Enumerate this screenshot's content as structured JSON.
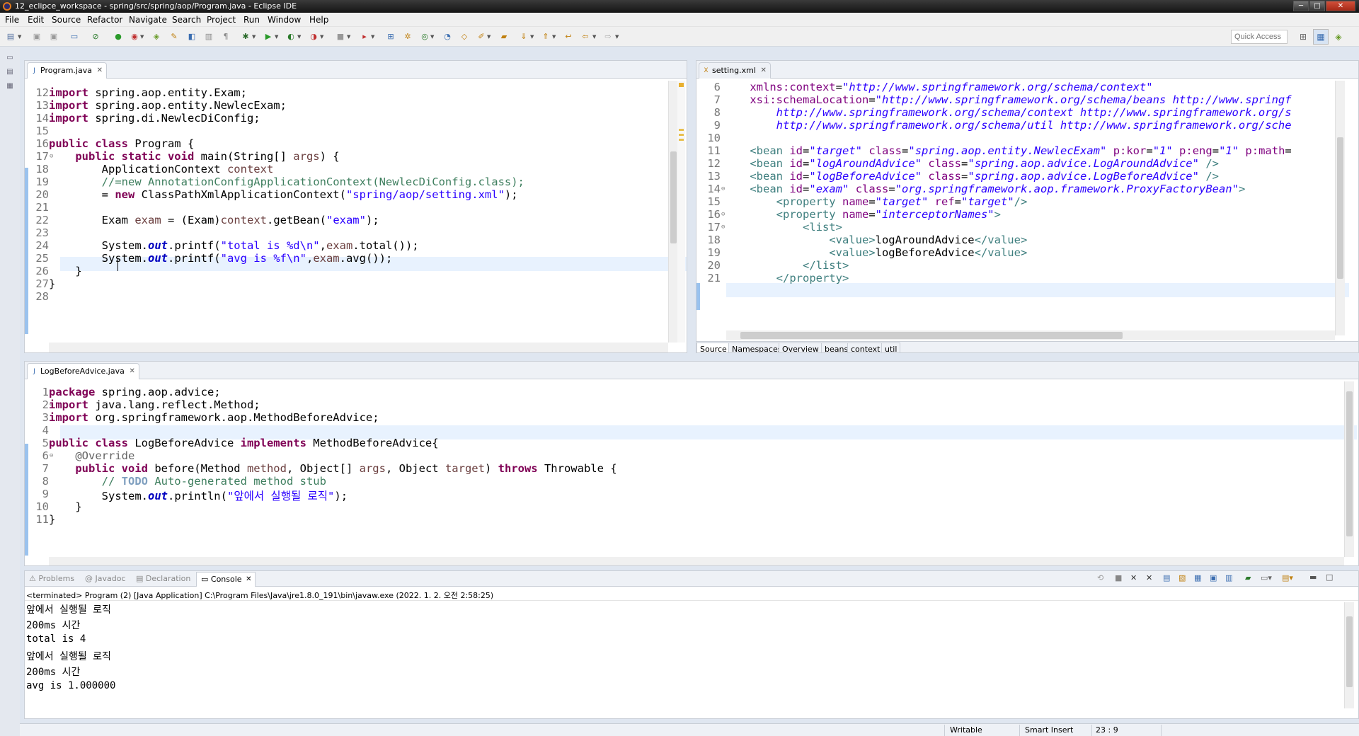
{
  "window": {
    "title": "12_eclipce_workspace - spring/src/spring/aop/Program.java - Eclipse IDE",
    "min": "─",
    "max": "□",
    "close": "✕"
  },
  "menu": [
    "File",
    "Edit",
    "Source",
    "Refactor",
    "Navigate",
    "Search",
    "Project",
    "Run",
    "Window",
    "Help"
  ],
  "toolbar": {
    "quick_access_placeholder": "Quick Access"
  },
  "editor_program": {
    "tab": "Program.java",
    "lines": [
      {
        "n": "12",
        "src": "<span class=\"kw\">import</span> spring.aop.entity.Exam;"
      },
      {
        "n": "13",
        "src": "<span class=\"kw\">import</span> spring.aop.entity.NewlecExam;"
      },
      {
        "n": "14",
        "src": "<span class=\"kw\">import</span> spring.di.NewlecDiConfig;"
      },
      {
        "n": "15",
        "src": ""
      },
      {
        "n": "16",
        "src": "<span class=\"kw\">public class</span> Program {"
      },
      {
        "n": "17",
        "src": "    <span class=\"kw\">public static void</span> main(String[] <span class=\"var\">args</span>) {"
      },
      {
        "n": "18",
        "src": "        ApplicationContext <span class=\"var\">context</span>"
      },
      {
        "n": "19",
        "src": "        <span class=\"cm\">//=new AnnotationConfigApplicationContext(NewlecDiConfig.class);</span>"
      },
      {
        "n": "20",
        "src": "        = <span class=\"kw\">new</span> ClassPathXmlApplicationContext(<span class=\"str\">\"spring/aop/setting.xml\"</span>);"
      },
      {
        "n": "21",
        "src": ""
      },
      {
        "n": "22",
        "src": "        Exam <span class=\"var\">exam</span> = (Exam)<span class=\"var\">context</span>.getBean(<span class=\"str\">\"exam\"</span>);"
      },
      {
        "n": "23",
        "src": "        "
      },
      {
        "n": "24",
        "src": "        System.<span class=\"fld\">out</span>.printf(<span class=\"str\">\"total is %d\\n\"</span>,<span class=\"var\">exam</span>.total());"
      },
      {
        "n": "25",
        "src": "        System.<span class=\"fld\">out</span>.printf(<span class=\"str\">\"avg is %f\\n\"</span>,<span class=\"var\">exam</span>.avg());"
      },
      {
        "n": "26",
        "src": "    }"
      },
      {
        "n": "27",
        "src": "}"
      },
      {
        "n": "28",
        "src": ""
      }
    ]
  },
  "editor_xml": {
    "tab": "setting.xml",
    "lines": [
      {
        "n": "6",
        "src": "    <span class=\"xa\">xmlns:context</span>=<span class=\"xv\">\"http://www.springframework.org/schema/context\"</span>"
      },
      {
        "n": "7",
        "src": "    <span class=\"xa\">xsi:schemaLocation</span>=<span class=\"xv\">\"http://www.springframework.org/schema/beans http://www.springf</span>"
      },
      {
        "n": "8",
        "src": "        <span class=\"xv\">http://www.springframework.org/schema/context http://www.springframework.org/s</span>"
      },
      {
        "n": "9",
        "src": "        <span class=\"xv\">http://www.springframework.org/schema/util http://www.springframework.org/sche</span>"
      },
      {
        "n": "10",
        "src": ""
      },
      {
        "n": "11",
        "src": "    <span class=\"xt\">&lt;bean</span> <span class=\"xa\">id</span>=<span class=\"xv\">\"target\"</span> <span class=\"xa\">class</span>=<span class=\"xv\">\"spring.aop.entity.NewlecExam\"</span> <span class=\"xa\">p:kor</span>=<span class=\"xv\">\"1\"</span> <span class=\"xa\">p:eng</span>=<span class=\"xv\">\"1\"</span> <span class=\"xa\">p:math</span>="
      },
      {
        "n": "12",
        "src": "    <span class=\"xt\">&lt;bean</span> <span class=\"xa\">id</span>=<span class=\"xv\">\"logAroundAdvice\"</span> <span class=\"xa\">class</span>=<span class=\"xv\">\"spring.aop.advice.LogAroundAdvice\"</span> <span class=\"xt\">/&gt;</span>"
      },
      {
        "n": "13",
        "src": "    <span class=\"xt\">&lt;bean</span> <span class=\"xa\">id</span>=<span class=\"xv\">\"logBeforeAdvice\"</span> <span class=\"xa\">class</span>=<span class=\"xv\">\"spring.aop.advice.LogBeforeAdvice\"</span> <span class=\"xt\">/&gt;</span>"
      },
      {
        "n": "14",
        "src": "    <span class=\"xt\">&lt;bean</span> <span class=\"xa\">id</span>=<span class=\"xv\">\"exam\"</span> <span class=\"xa\">class</span>=<span class=\"xv\">\"org.springframework.aop.framework.ProxyFactoryBean\"</span><span class=\"xt\">&gt;</span>"
      },
      {
        "n": "15",
        "src": "        <span class=\"xt\">&lt;property</span> <span class=\"xa\">name</span>=<span class=\"xv\">\"target\"</span> <span class=\"xa\">ref</span>=<span class=\"xv\">\"target\"</span><span class=\"xt\">/&gt;</span>"
      },
      {
        "n": "16",
        "src": "        <span class=\"xt\">&lt;property</span> <span class=\"xa\">name</span>=<span class=\"xv\">\"interceptorNames\"</span><span class=\"xt\">&gt;</span>"
      },
      {
        "n": "17",
        "src": "            <span class=\"xt\">&lt;list&gt;</span>"
      },
      {
        "n": "18",
        "src": "                <span class=\"xt\">&lt;value&gt;</span>logAroundAdvice<span class=\"xt\">&lt;/value&gt;</span>"
      },
      {
        "n": "19",
        "src": "                <span class=\"xt\">&lt;value&gt;</span>logBeforeAdvice<span class=\"xt\">&lt;/value&gt;</span>"
      },
      {
        "n": "20",
        "src": "            <span class=\"xt\">&lt;/list&gt;</span>"
      },
      {
        "n": "21",
        "src": "        <span class=\"xt\">&lt;/property&gt;</span>"
      }
    ],
    "bottom_tabs": [
      "Source",
      "Namespaces",
      "Overview",
      "beans",
      "context",
      "util"
    ]
  },
  "editor_advice": {
    "tab": "LogBeforeAdvice.java",
    "lines": [
      {
        "n": "1",
        "src": "<span class=\"kw\">package</span> spring.aop.advice;"
      },
      {
        "n": "2",
        "src": "<span class=\"kw\">import</span> java.lang.reflect.Method;"
      },
      {
        "n": "3",
        "src": "<span class=\"kw\">import</span> org.springframework.aop.MethodBeforeAdvice;"
      },
      {
        "n": "4",
        "src": ""
      },
      {
        "n": "5",
        "src": "<span class=\"kw\">public class</span> LogBeforeAdvice <span class=\"kw\">implements</span> MethodBeforeAdvice{"
      },
      {
        "n": "6",
        "src": "    <span class=\"ann\">@Override</span>"
      },
      {
        "n": "7",
        "src": "    <span class=\"kw\">public void</span> before(Method <span class=\"var\">method</span>, Object[] <span class=\"var\">args</span>, Object <span class=\"var\">target</span>) <span class=\"kw\">throws</span> Throwable {"
      },
      {
        "n": "8",
        "src": "        <span class=\"cm\">// <span class=\"todo\">TODO</span> Auto-generated method stub</span>"
      },
      {
        "n": "9",
        "src": "        System.<span class=\"fld\">out</span>.println(<span class=\"str\">\"앞에서 실행될 로직\"</span>);"
      },
      {
        "n": "10",
        "src": "    }"
      },
      {
        "n": "11",
        "src": "}"
      }
    ]
  },
  "console": {
    "tabs": [
      "Problems",
      "Javadoc",
      "Declaration",
      "Console"
    ],
    "status": "<terminated> Program (2) [Java Application] C:\\Program Files\\Java\\jre1.8.0_191\\bin\\javaw.exe (2022. 1. 2. 오전 2:58:25)",
    "output": [
      "앞에서 실행될 로직",
      "200ms 시간",
      "total is 4",
      "앞에서 실행될 로직",
      "200ms 시간",
      "avg is 1.000000"
    ]
  },
  "statusbar": {
    "writable": "Writable",
    "insert_mode": "Smart Insert",
    "position": "23 : 9"
  }
}
